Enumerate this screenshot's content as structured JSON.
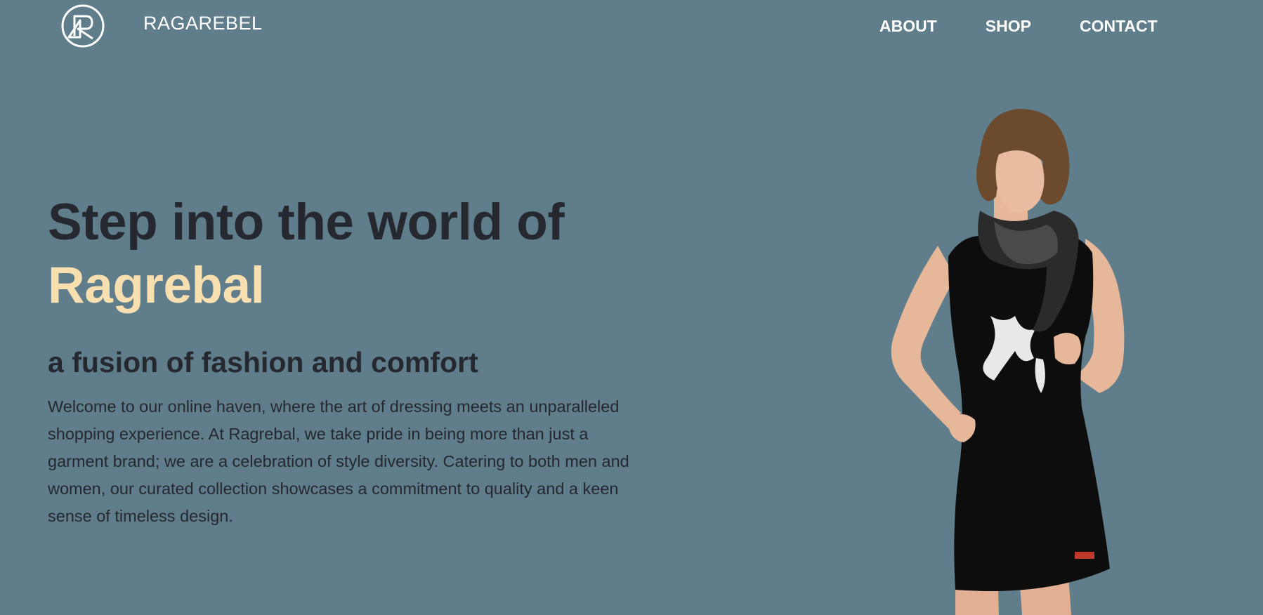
{
  "header": {
    "brand": "RAGAREBEL",
    "nav": [
      {
        "label": "ABOUT"
      },
      {
        "label": "SHOP"
      },
      {
        "label": "CONTACT"
      }
    ]
  },
  "hero": {
    "headline": "Step into the world of",
    "headline_accent": "Ragrebal",
    "subheadline": "a fusion of fashion and comfort",
    "description": "Welcome to our online haven, where the art of dressing meets an unparalleled shopping experience. At Ragrebal, we take pride in being more than just a garment brand; we are a celebration of style diversity. Catering to both men and women, our curated collection showcases a commitment to quality and a keen sense of timeless design."
  },
  "colors": {
    "background": "#607d8b",
    "accent": "#f7dfb0",
    "text_dark": "#25282e",
    "nav_text": "#ffffff"
  },
  "icons": {
    "logo": "rr-circle-logo"
  }
}
